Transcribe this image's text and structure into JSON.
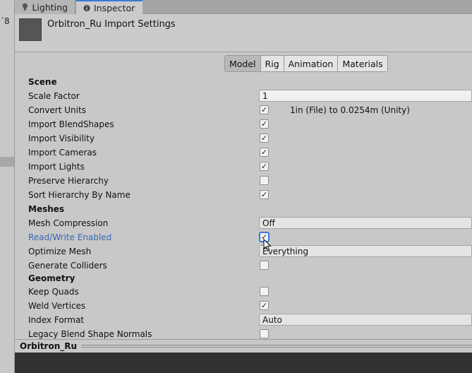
{
  "left_panel": {
    "fragment": "´8"
  },
  "tabs": [
    {
      "label": "Lighting",
      "icon": "lightbulb-icon",
      "active": false
    },
    {
      "label": "Inspector",
      "icon": "info-icon",
      "active": true
    }
  ],
  "header": {
    "title": "Orbitron_Ru Import Settings"
  },
  "toolbar": {
    "buttons": [
      "Model",
      "Rig",
      "Animation",
      "Materials"
    ],
    "selected": "Model"
  },
  "sections": {
    "scene": "Scene",
    "meshes": "Meshes",
    "geometry": "Geometry"
  },
  "fields": {
    "scale_factor": {
      "label": "Scale Factor",
      "value": "1"
    },
    "convert_units": {
      "label": "Convert Units",
      "checked": true,
      "note": "1in (File) to 0.0254m (Unity)"
    },
    "import_blendshapes": {
      "label": "Import BlendShapes",
      "checked": true
    },
    "import_visibility": {
      "label": "Import Visibility",
      "checked": true
    },
    "import_cameras": {
      "label": "Import Cameras",
      "checked": true
    },
    "import_lights": {
      "label": "Import Lights",
      "checked": true
    },
    "preserve_hierarchy": {
      "label": "Preserve Hierarchy",
      "checked": false
    },
    "sort_hierarchy": {
      "label": "Sort Hierarchy By Name",
      "checked": true
    },
    "mesh_compression": {
      "label": "Mesh Compression",
      "value": "Off"
    },
    "read_write": {
      "label": "Read/Write Enabled",
      "checked": true
    },
    "optimize_mesh": {
      "label": "Optimize Mesh",
      "value": "Everything"
    },
    "generate_colliders": {
      "label": "Generate Colliders",
      "checked": false
    },
    "keep_quads": {
      "label": "Keep Quads",
      "checked": false
    },
    "weld_vertices": {
      "label": "Weld Vertices",
      "checked": true
    },
    "index_format": {
      "label": "Index Format",
      "value": "Auto"
    },
    "legacy_blend": {
      "label": "Legacy Blend Shape Normals",
      "checked": false
    }
  },
  "check_glyph": "✓",
  "footer": {
    "asset_name": "Orbitron_Ru"
  },
  "colors": {
    "accent": "#3a79d6",
    "highlight_label": "#3869b3",
    "preview_bg": "#313131"
  }
}
